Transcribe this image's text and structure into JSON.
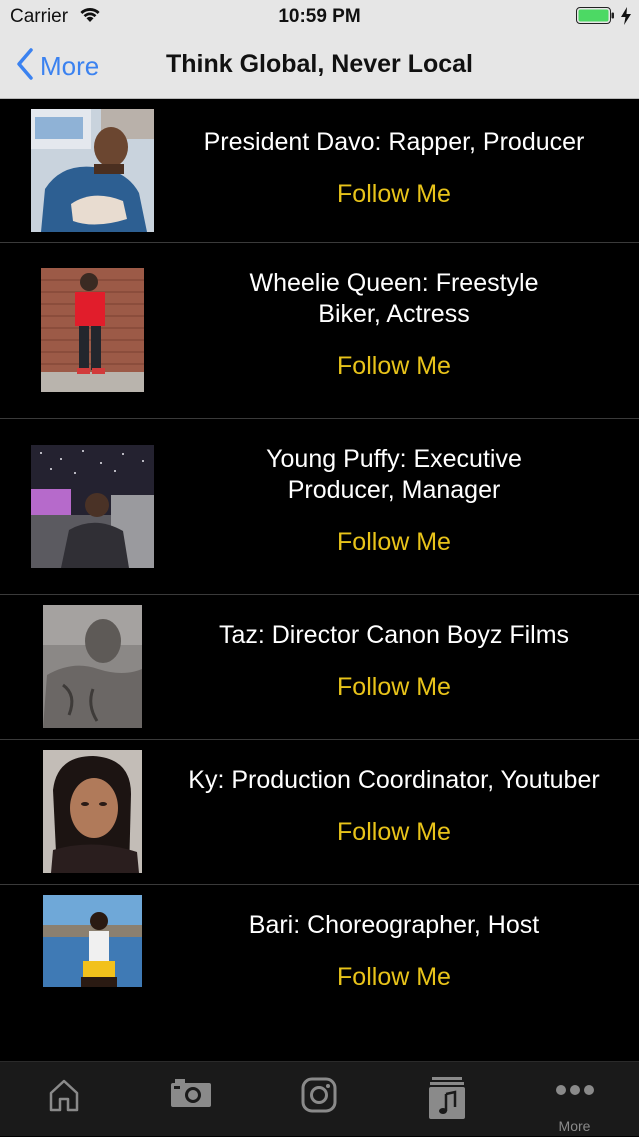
{
  "status_bar": {
    "carrier": "Carrier",
    "time": "10:59 PM"
  },
  "nav": {
    "back_label": "More",
    "title": "Think Global, Never Local"
  },
  "colors": {
    "accent_yellow": "#e8c31a",
    "back_blue": "#3b82f0",
    "battery_green": "#4cd964"
  },
  "rows": [
    {
      "name": "President Davo: Rapper, Producer",
      "follow": "Follow Me"
    },
    {
      "name": "Wheelie Queen: Freestyle Biker, Actress",
      "follow": "Follow Me"
    },
    {
      "name": "Young Puffy: Executive Producer, Manager",
      "follow": "Follow Me"
    },
    {
      "name": "Taz: Director Canon Boyz Films",
      "follow": "Follow Me"
    },
    {
      "name": "Ky: Production Coordinator, Youtuber",
      "follow": "Follow Me"
    },
    {
      "name": "Bari: Choreographer, Host",
      "follow": "Follow Me"
    }
  ],
  "tabs": [
    {
      "icon": "home-icon",
      "label": ""
    },
    {
      "icon": "camera-icon",
      "label": ""
    },
    {
      "icon": "instagram-icon",
      "label": ""
    },
    {
      "icon": "music-library-icon",
      "label": ""
    },
    {
      "icon": "more-icon",
      "label": "More"
    }
  ]
}
